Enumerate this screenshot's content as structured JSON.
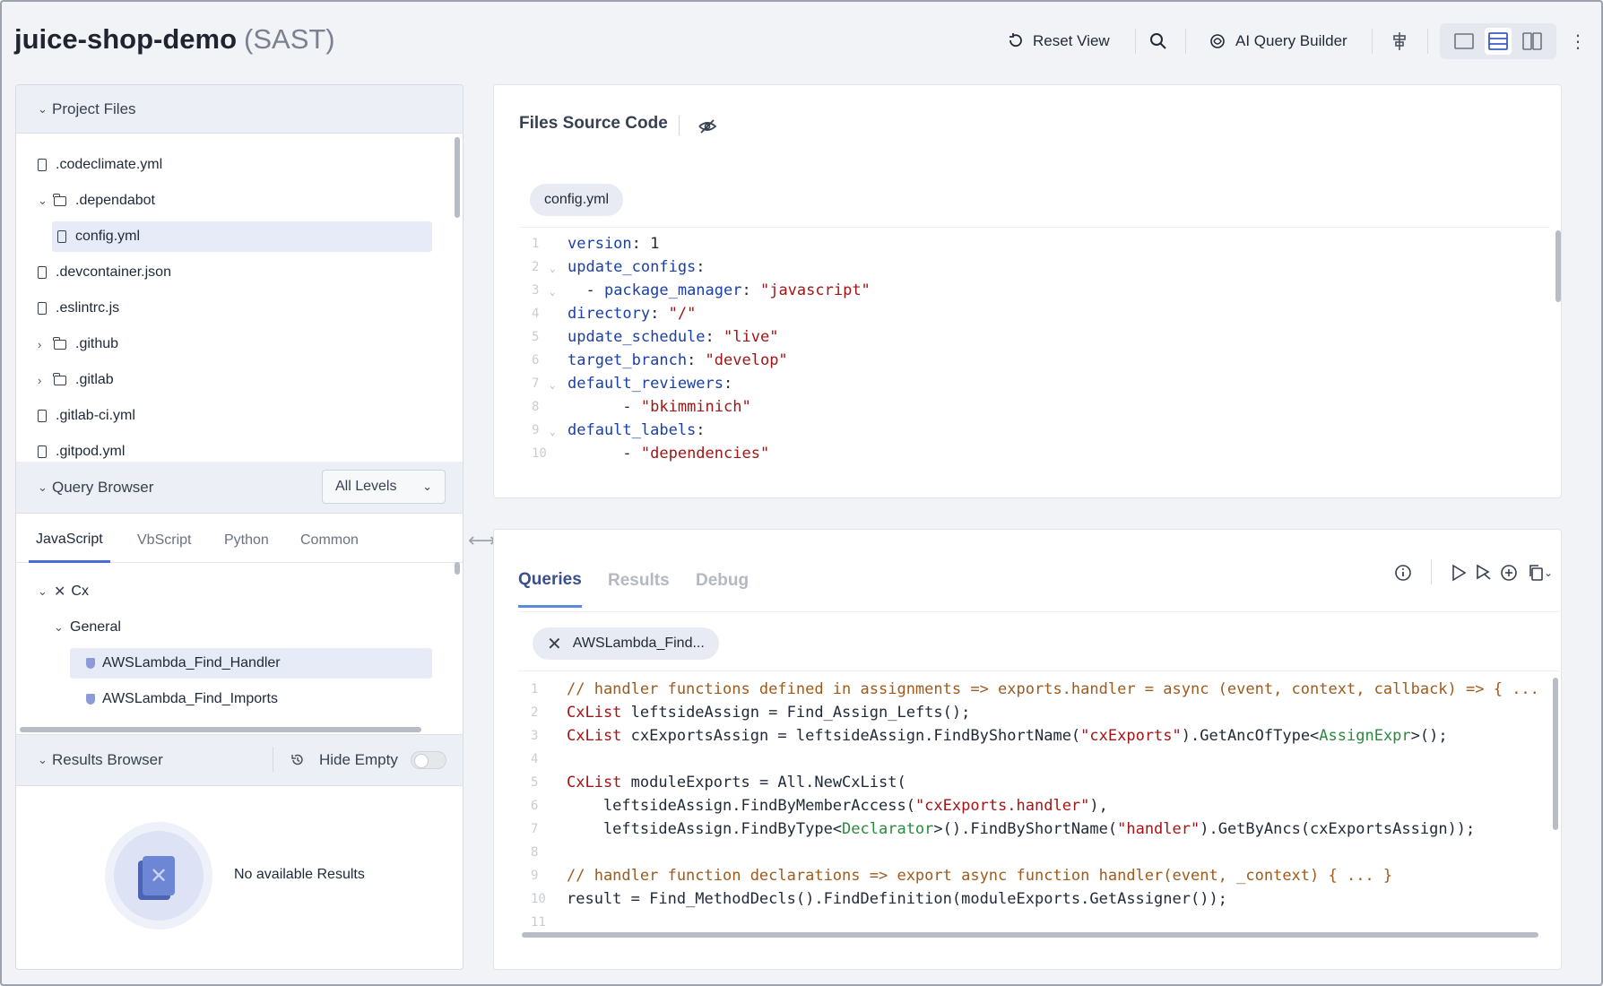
{
  "header": {
    "title": "juice-shop-demo",
    "subtitle": "(SAST)",
    "reset_view": "Reset View",
    "ai_query_builder": "AI Query Builder"
  },
  "project_files": {
    "title": "Project Files",
    "items": [
      {
        "label": ".codeclimate.yml",
        "type": "file"
      },
      {
        "label": ".dependabot",
        "type": "folder",
        "expanded": true
      },
      {
        "label": "config.yml",
        "type": "file",
        "selected": true
      },
      {
        "label": ".devcontainer.json",
        "type": "file"
      },
      {
        "label": ".eslintrc.js",
        "type": "file"
      },
      {
        "label": ".github",
        "type": "folder",
        "expanded": false
      },
      {
        "label": ".gitlab",
        "type": "folder",
        "expanded": false
      },
      {
        "label": ".gitlab-ci.yml",
        "type": "file"
      },
      {
        "label": ".gitpod.yml",
        "type": "file"
      }
    ]
  },
  "query_browser": {
    "title": "Query Browser",
    "level_select": "All Levels",
    "tabs": [
      "JavaScript",
      "VbScript",
      "Python",
      "Common"
    ],
    "active_tab": "JavaScript",
    "tree": {
      "root": "Cx",
      "group": "General",
      "queries": [
        "AWSLambda_Find_Handler",
        "AWSLambda_Find_Imports"
      ]
    }
  },
  "results_browser": {
    "title": "Results Browser",
    "hide_empty": "Hide Empty",
    "empty_text": "No available Results"
  },
  "source_panel": {
    "title": "Files Source Code",
    "file_tab": "config.yml",
    "line_numbers": [
      "1",
      "2",
      "3",
      "4",
      "5",
      "6",
      "7",
      "8",
      "9",
      "10"
    ],
    "lines": [
      "version: 1",
      "update_configs:",
      "  - package_manager: \"javascript\"",
      "    directory: \"/\"",
      "    update_schedule: \"live\"",
      "    target_branch: \"develop\"",
      "    default_reviewers:",
      "      - \"bkimminich\"",
      "    default_labels:",
      "      - \"dependencies\""
    ]
  },
  "queries_panel": {
    "tabs": [
      "Queries",
      "Results",
      "Debug"
    ],
    "active_tab": "Queries",
    "query_tab": "AWSLambda_Find...",
    "line_numbers": [
      "1",
      "2",
      "3",
      "4",
      "5",
      "6",
      "7",
      "8",
      "9",
      "10",
      "11"
    ],
    "lines": [
      "// handler functions defined in assignments => exports.handler = async (event, context, callback) => { ...",
      "CxList leftsideAssign = Find_Assign_Lefts();",
      "CxList cxExportsAssign = leftsideAssign.FindByShortName(\"cxExports\").GetAncOfType<AssignExpr>();",
      "",
      "CxList moduleExports = All.NewCxList(",
      "    leftsideAssign.FindByMemberAccess(\"cxExports.handler\"),",
      "    leftsideAssign.FindByType<Declarator>().FindByShortName(\"handler\").GetByAncs(cxExportsAssign));",
      "",
      "// handler function declarations => export async function handler(event, _context) { ... }",
      "result = Find_MethodDecls().FindDefinition(moduleExports.GetAssigner());",
      ""
    ]
  }
}
